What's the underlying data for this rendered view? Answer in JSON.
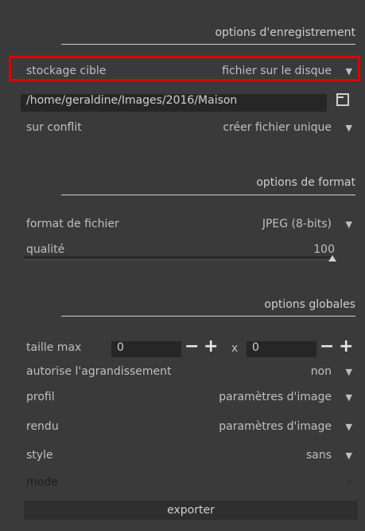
{
  "sections": {
    "storage": "options d'enregistrement",
    "format": "options de format",
    "global": "options globales"
  },
  "storage": {
    "target_label": "stockage cible",
    "target_value": "fichier sur le disque",
    "path": "/home/geraldine/Images/2016/Maison",
    "conflict_label": "sur conflit",
    "conflict_value": "créer fichier unique"
  },
  "format": {
    "file_format_label": "format de fichier",
    "file_format_value": "JPEG (8-bits)",
    "quality_label": "qualité",
    "quality_value": "100"
  },
  "global": {
    "max_size_label": "taille max",
    "width_value": "0",
    "height_value": "0",
    "x_label": "x",
    "upscale_label": "autorise l'agrandissement",
    "upscale_value": "non",
    "profile_label": "profil",
    "profile_value": "paramètres d'image",
    "intent_label": "rendu",
    "intent_value": "paramètres d'image",
    "style_label": "style",
    "style_value": "sans",
    "mode_label": "mode"
  },
  "actions": {
    "export": "exporter"
  },
  "colors": {
    "highlight": "#e00000",
    "background": "#3a3a3a"
  }
}
